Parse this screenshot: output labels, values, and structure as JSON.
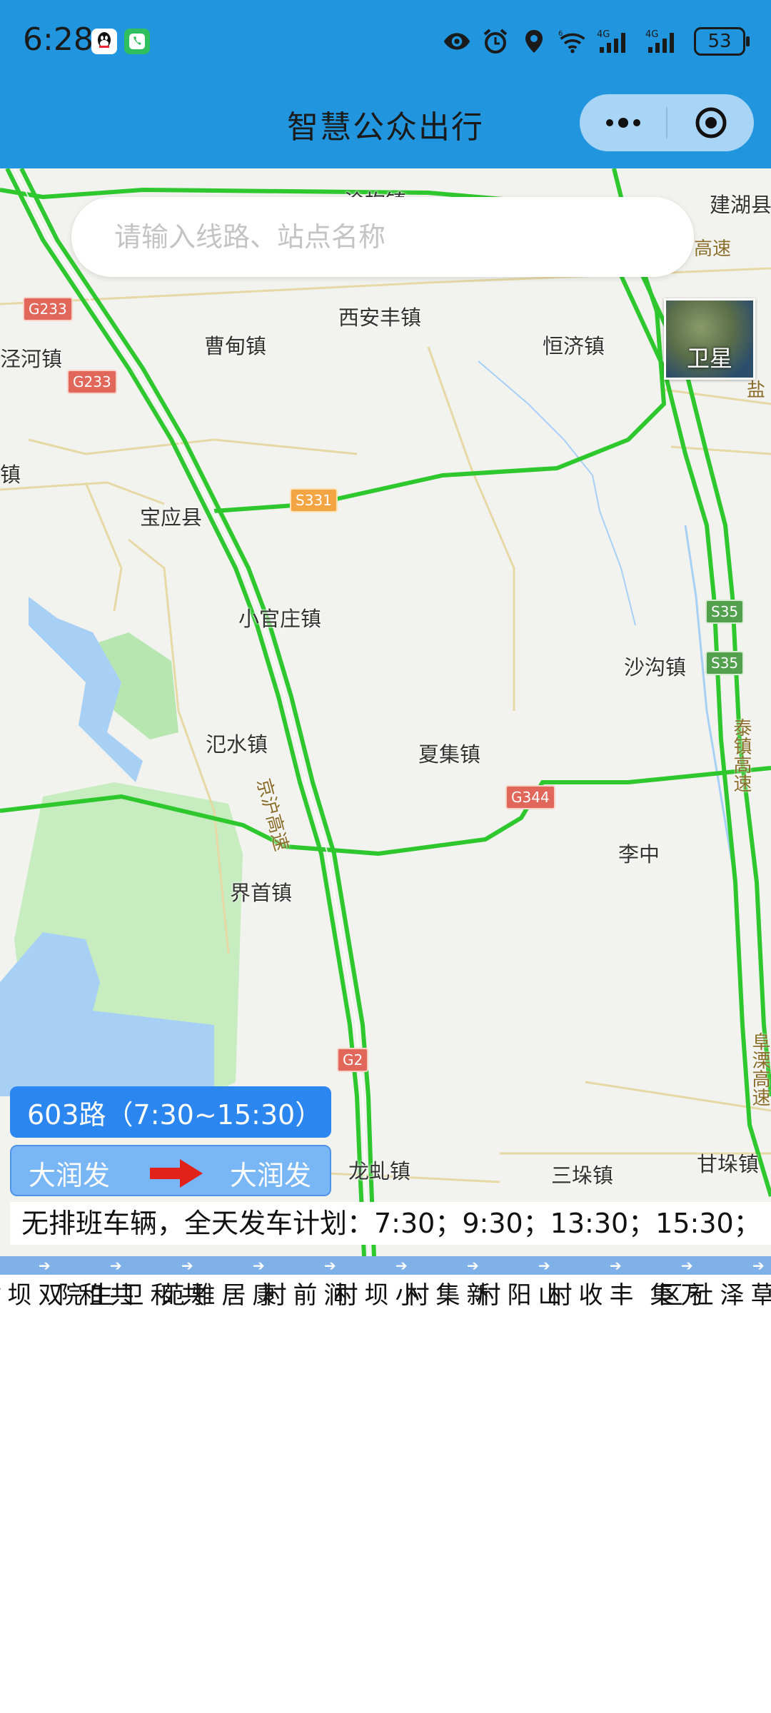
{
  "status_bar": {
    "time": "6:28",
    "battery": "53",
    "network_1": "4G",
    "network_2": "4G",
    "wifi_label": "6"
  },
  "header": {
    "title": "智慧公众出行",
    "more_icon": "more-dots-icon",
    "close_icon": "target-circle-icon"
  },
  "search": {
    "placeholder": "请输入线路、站点名称"
  },
  "map": {
    "satellite_label": "卫星",
    "towns": [
      "涂构镇",
      "建湖县",
      "西安丰镇",
      "曹甸镇",
      "恒济镇",
      "泾河镇",
      "镇",
      "宝应县",
      "小官庄镇",
      "沙沟镇",
      "氾水镇",
      "夏集镇",
      "李中",
      "界首镇",
      "龙虬镇",
      "三垛镇",
      "甘垛镇"
    ],
    "shields": [
      "G233",
      "G233",
      "S331",
      "S35",
      "S35",
      "G344",
      "G2"
    ],
    "road_names": [
      "高速",
      "京沪高速",
      "泰镇高速",
      "阜溧高速",
      "盐"
    ]
  },
  "route": {
    "badge": "603路（7:30~15:30）",
    "from": "大润发",
    "to": "大润发",
    "notice": "无排班车辆，全天发车计划：7:30；9:30；13:30；15:30；"
  },
  "stops": [
    "双坝村",
    "共和",
    "共和卫生院",
    "康居雅苑",
    "涧前村",
    "小坝村",
    "新集村",
    "山阳村",
    "丰收村",
    "万集",
    "草泽社区"
  ],
  "colors": {
    "header": "#2196df",
    "route_badge": "#2b86f0",
    "direction": "#79b6f5",
    "road_green": "#2ec82e",
    "arrow_red": "#e0221b"
  }
}
